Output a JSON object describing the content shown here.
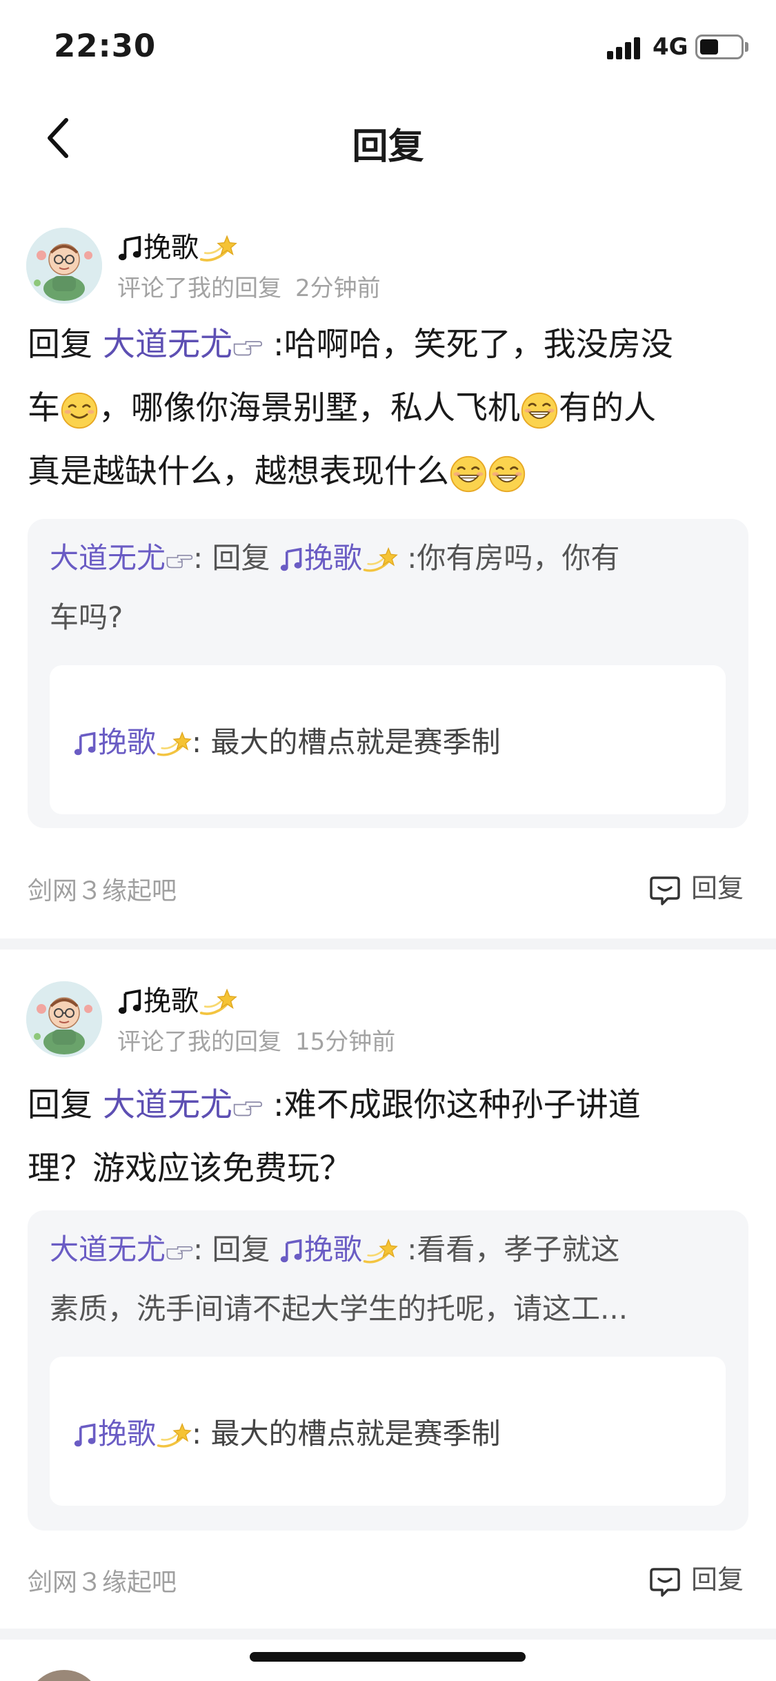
{
  "status_bar": {
    "time": "22:30",
    "network": "4G"
  },
  "nav": {
    "title": "回复"
  },
  "comments": [
    {
      "user": "挽歌",
      "action": "评论了我的回复",
      "time": "2分钟前",
      "reply_prefix": "回复",
      "reply_to": "大道无尤",
      "reply_line1": ":哈啊哈，笑死了，我没房没",
      "reply_line2a": "车",
      "reply_line2b": "，哪像你海景别墅，私人飞机",
      "reply_line2c": "有的人",
      "reply_line3": "真是越缺什么，越想表现什么",
      "quote_user": "大道无尤",
      "quote_prefix": ": 回复",
      "quote_to": "挽歌",
      "quote_line1": ":你有房吗，你有",
      "quote_line2": "车吗?",
      "inner_user": "挽歌",
      "inner_text": ": 最大的槽点就是赛季制",
      "source": "剑网３缘起吧",
      "reply_label": "回复"
    },
    {
      "user": "挽歌",
      "action": "评论了我的回复",
      "time": "15分钟前",
      "reply_prefix": "回复",
      "reply_to": "大道无尤",
      "reply_line1": ":难不成跟你这种孙子讲道",
      "reply_line2": "理？游戏应该免费玩？",
      "quote_user": "大道无尤",
      "quote_prefix": ": 回复",
      "quote_to": "挽歌",
      "quote_line1": ":看看，孝子就这",
      "quote_line2": "素质，洗手间请不起大学生的托呢，请这工...",
      "inner_user": "挽歌",
      "inner_text": ": 最大的槽点就是赛季制",
      "source": "剑网３缘起吧",
      "reply_label": "回复"
    }
  ],
  "icons": {
    "note": "musical-note-icon",
    "star": "dizzy-star-icon",
    "hand": "pointing-hand-icon",
    "grin": "grinning-face-icon",
    "reply": "reply-bubble-icon",
    "back": "back-chevron-icon"
  },
  "colors": {
    "mention": "#5d4fb3",
    "muted": "#a3a3a3",
    "quote_bg": "#f5f6f8",
    "divider": "#f3f4f6"
  }
}
